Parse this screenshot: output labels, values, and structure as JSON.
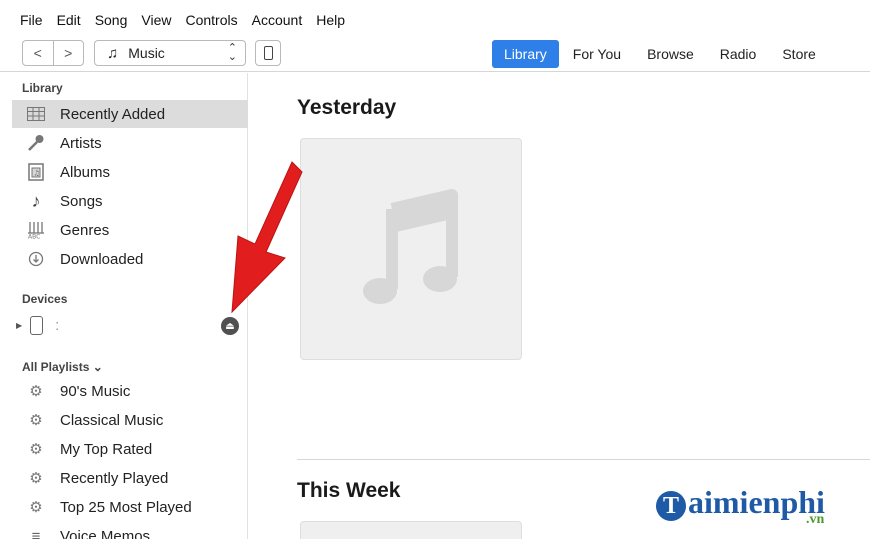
{
  "menu": [
    "File",
    "Edit",
    "Song",
    "View",
    "Controls",
    "Account",
    "Help"
  ],
  "toolbar": {
    "back_glyph": "<",
    "forward_glyph": ">",
    "media_label": "Music",
    "tabs": [
      {
        "label": "Library",
        "active": true
      },
      {
        "label": "For You",
        "active": false
      },
      {
        "label": "Browse",
        "active": false
      },
      {
        "label": "Radio",
        "active": false
      },
      {
        "label": "Store",
        "active": false
      }
    ]
  },
  "sidebar": {
    "library_title": "Library",
    "library_items": [
      {
        "label": "Recently Added",
        "icon": "grid-icon",
        "selected": true
      },
      {
        "label": "Artists",
        "icon": "microphone-icon",
        "selected": false
      },
      {
        "label": "Albums",
        "icon": "album-icon",
        "selected": false
      },
      {
        "label": "Songs",
        "icon": "note-icon",
        "selected": false
      },
      {
        "label": "Genres",
        "icon": "genres-icon",
        "selected": false
      },
      {
        "label": "Downloaded",
        "icon": "download-icon",
        "selected": false
      }
    ],
    "devices_title": "Devices",
    "device_name": ":",
    "playlists_title": "All Playlists ⌄",
    "playlists": [
      {
        "label": "90's Music",
        "icon": "gear-icon"
      },
      {
        "label": "Classical Music",
        "icon": "gear-icon"
      },
      {
        "label": "My Top Rated",
        "icon": "gear-icon"
      },
      {
        "label": "Recently Played",
        "icon": "gear-icon"
      },
      {
        "label": "Top 25 Most Played",
        "icon": "gear-icon"
      },
      {
        "label": "Voice Memos",
        "icon": "list-icon"
      }
    ]
  },
  "main": {
    "section1_title": "Yesterday",
    "section2_title": "This Week"
  },
  "watermark": {
    "text": "aimienphi",
    "initial": "T",
    "suffix": ".vn"
  },
  "colors": {
    "accent": "#2e7fe8",
    "arrow": "#e11d1d"
  }
}
